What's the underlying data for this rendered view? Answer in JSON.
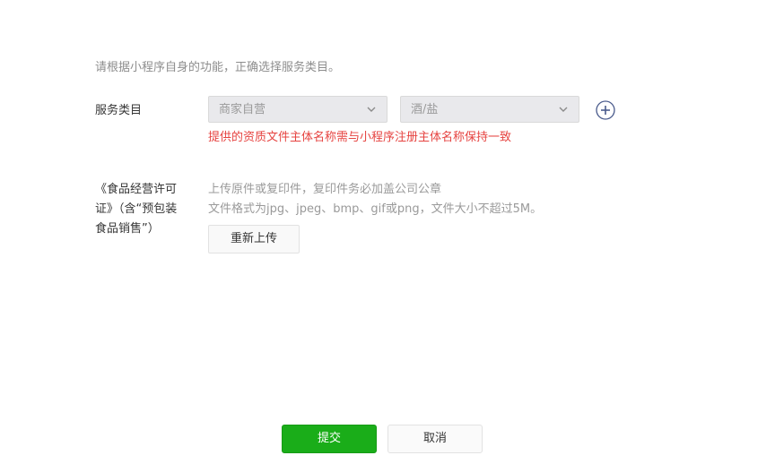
{
  "intro_text": "请根据小程序自身的功能，正确选择服务类目。",
  "service_category": {
    "label": "服务类目",
    "primary_value": "商家自营",
    "secondary_value": "酒/盐",
    "add_icon": "plus-circle-icon",
    "warning": "提供的资质文件主体名称需与小程序注册主体名称保持一致"
  },
  "license": {
    "label": "《食品经营许可证》（含“预包装食品销售”）",
    "hint_line1": "上传原件或复印件，复印件务必加盖公司公章",
    "hint_line2": "文件格式为jpg、jpeg、bmp、gif或png，文件大小不超过5M。",
    "reupload_label": "重新上传"
  },
  "actions": {
    "submit_label": "提交",
    "cancel_label": "取消"
  },
  "colors": {
    "submit": "#1aad19",
    "warning": "#e64340",
    "add_icon": "#4a5b8c"
  }
}
